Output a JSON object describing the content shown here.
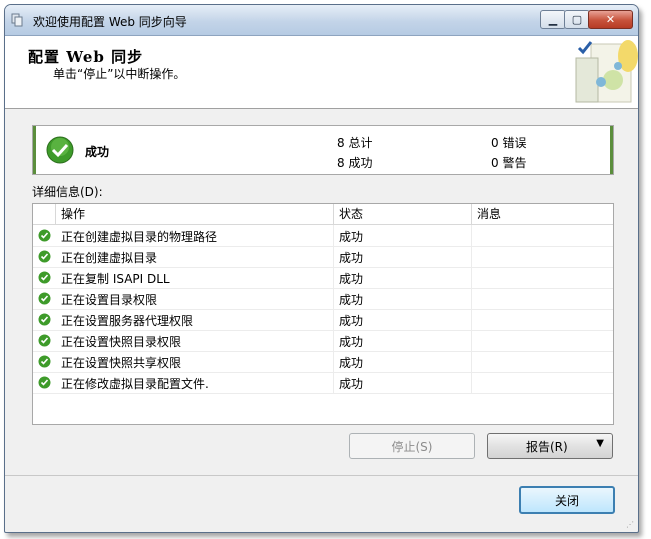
{
  "window": {
    "title": "欢迎使用配置 Web 同步向导"
  },
  "header": {
    "title": "配置 Web 同步",
    "subtitle": "单击“停止”以中断操作。"
  },
  "summary": {
    "status": "成功",
    "total": "8 总计",
    "success": "8 成功",
    "errors": "0 错误",
    "warnings": "0 警告"
  },
  "details_label": "详细信息(D):",
  "table": {
    "columns": [
      "操作",
      "状态",
      "消息"
    ],
    "rows": [
      {
        "action": "正在创建虚拟目录的物理路径",
        "status": "成功",
        "message": ""
      },
      {
        "action": "正在创建虚拟目录",
        "status": "成功",
        "message": ""
      },
      {
        "action": "正在复制 ISAPI DLL",
        "status": "成功",
        "message": ""
      },
      {
        "action": "正在设置目录权限",
        "status": "成功",
        "message": ""
      },
      {
        "action": "正在设置服务器代理权限",
        "status": "成功",
        "message": ""
      },
      {
        "action": "正在设置快照目录权限",
        "status": "成功",
        "message": ""
      },
      {
        "action": "正在设置快照共享权限",
        "status": "成功",
        "message": ""
      },
      {
        "action": "正在修改虚拟目录配置文件.",
        "status": "成功",
        "message": ""
      }
    ]
  },
  "buttons": {
    "stop": "停止(S)",
    "report": "报告(R)",
    "close": "关闭"
  },
  "icons": {
    "success": "success-check-icon",
    "app": "app-icon"
  },
  "colors": {
    "success": "#3e9b2a",
    "accent": "#3c7fb1"
  }
}
